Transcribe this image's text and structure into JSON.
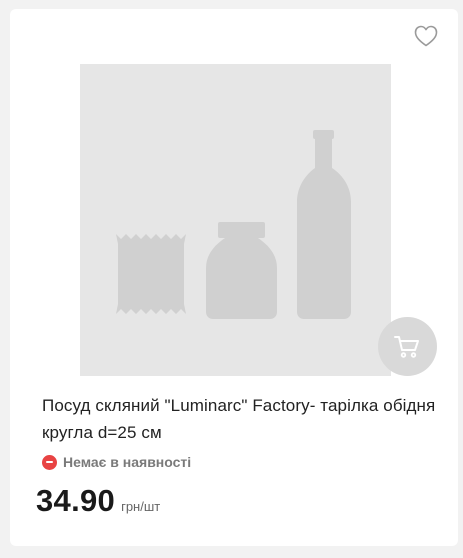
{
  "product": {
    "title": "Посуд скляний \"Luminarc\" Factory- тарілка обідня кругла d=25 см",
    "availability": "Немає в наявності",
    "price": "34.90",
    "unit": "грн/шт"
  },
  "icons": {
    "favorite": "heart-outline-icon",
    "cart": "shopping-cart-icon",
    "availability": "minus-circle-icon",
    "placeholder": "product-placeholder-image"
  },
  "colors": {
    "out_of_stock": "#e84343",
    "placeholder_bg": "#e6e6e6",
    "placeholder_shape": "#d0d0d0",
    "cart_button": "#d9d9d9"
  }
}
